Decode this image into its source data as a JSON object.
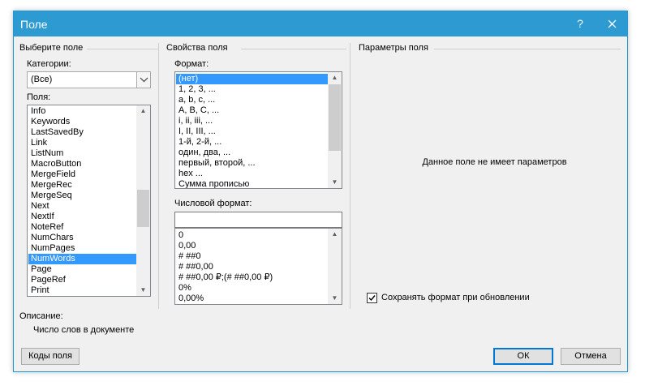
{
  "window": {
    "title": "Поле",
    "help_glyph": "?",
    "close_glyph": "✕"
  },
  "left": {
    "section_title": "Выберите поле",
    "categories_label": "Категории:",
    "categories_value": "(Все)",
    "fields_label": "Поля:",
    "fields": [
      "Info",
      "Keywords",
      "LastSavedBy",
      "Link",
      "ListNum",
      "MacroButton",
      "MergeField",
      "MergeRec",
      "MergeSeq",
      "Next",
      "NextIf",
      "NoteRef",
      "NumChars",
      "NumPages",
      "NumWords",
      "Page",
      "PageRef",
      "Print"
    ],
    "selected_field": "NumWords",
    "description_label": "Описание:",
    "description_text": "Число слов в документе",
    "field_codes_button": "Коды поля"
  },
  "middle": {
    "section_title": "Свойства поля",
    "format_label": "Формат:",
    "formats": [
      "(нет)",
      "1, 2, 3, ...",
      "a, b, c, ...",
      "A, B, C, ...",
      "i, ii, iii, ...",
      "I, II, III, ...",
      "1-й, 2-й, ...",
      "один, два, ...",
      "первый, второй, ...",
      "hex ...",
      "Сумма прописью"
    ],
    "selected_format": "(нет)",
    "numeric_format_label": "Числовой формат:",
    "numeric_format_value": "",
    "numeric_formats": [
      "0",
      "0,00",
      "# ##0",
      "# ##0,00",
      "# ##0,00 ₽;(# ##0,00 ₽)",
      "0%",
      "0,00%"
    ]
  },
  "right": {
    "section_title": "Параметры поля",
    "no_params_text": "Данное поле не имеет параметров",
    "preserve_format_label": "Сохранять формат при обновлении",
    "preserve_format_checked": true
  },
  "buttons": {
    "ok": "ОК",
    "cancel": "Отмена"
  },
  "icons": {
    "dropdown": "chevron-down-icon",
    "scroll_up": "scroll-up-arrow-icon",
    "scroll_down": "scroll-down-arrow-icon",
    "check": "checkmark-icon"
  },
  "colors": {
    "title_bar": "#2d9bd2",
    "selection": "#3399ff",
    "dialog_bg": "#f0f0f0",
    "default_button_border": "#0078d7"
  }
}
